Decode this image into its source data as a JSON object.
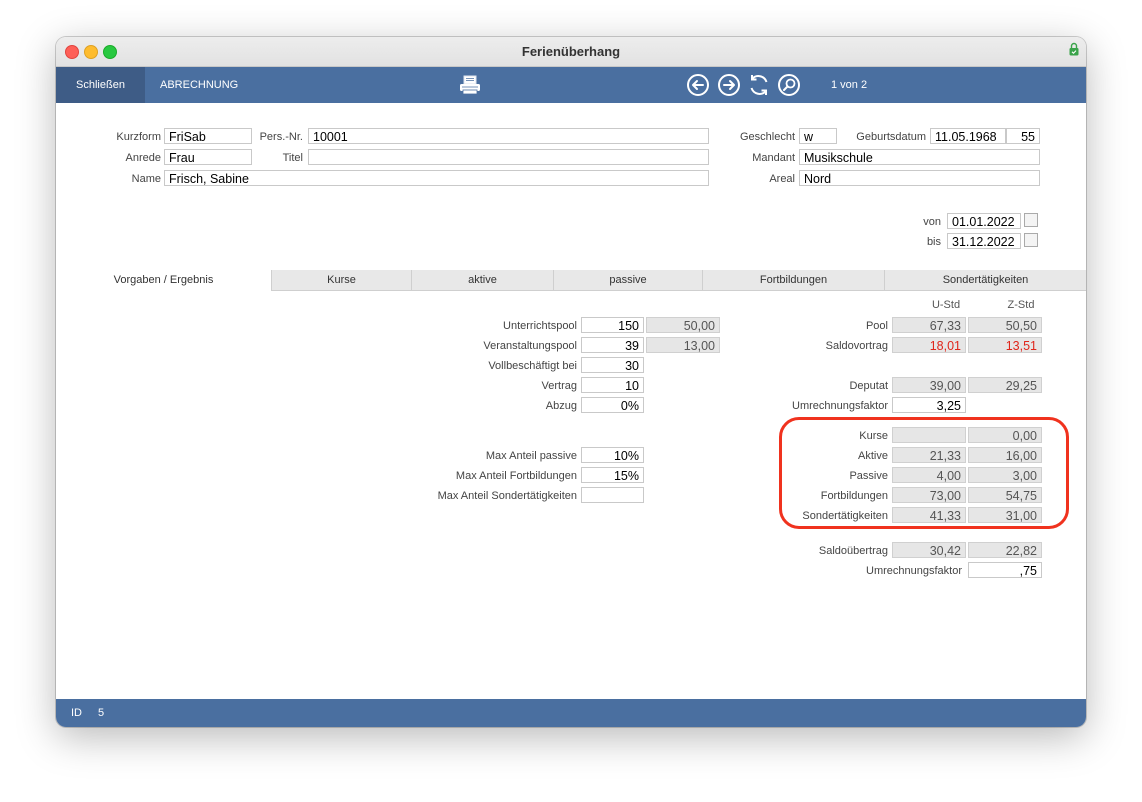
{
  "window": {
    "title": "Ferienüberhang"
  },
  "toolbar": {
    "close_label": "Schließen",
    "billing_label": "ABRECHNUNG",
    "record_info": "1 von 2"
  },
  "person": {
    "kurzform_label": "Kurzform",
    "kurzform": "FriSab",
    "persnr_label": "Pers.-Nr.",
    "persnr": "10001",
    "anrede_label": "Anrede",
    "anrede": "Frau",
    "titel_label": "Titel",
    "titel": "",
    "name_label": "Name",
    "name": "Frisch, Sabine",
    "geschlecht_label": "Geschlecht",
    "geschlecht": "w",
    "geburtsdatum_label": "Geburtsdatum",
    "geburtsdatum": "11.05.1968",
    "alter": "55",
    "mandant_label": "Mandant",
    "mandant": "Musikschule",
    "areal_label": "Areal",
    "areal": "Nord"
  },
  "period": {
    "von_label": "von",
    "von": "01.01.2022",
    "bis_label": "bis",
    "bis": "31.12.2022"
  },
  "tabs": [
    "Vorgaben / Ergebnis",
    "Kurse",
    "aktive",
    "passive",
    "Fortbildungen",
    "Sondertätigkeiten"
  ],
  "left": {
    "unterrichtspool_label": "Unterrichtspool",
    "unterrichtspool": "150",
    "unterrichtspool_z": "50,00",
    "veranstaltungspool_label": "Veranstaltungspool",
    "veranstaltungspool": "39",
    "veranstaltungspool_z": "13,00",
    "vollbeschaeftigt_label": "Vollbeschäftigt bei",
    "vollbeschaeftigt": "30",
    "vertrag_label": "Vertrag",
    "vertrag": "10",
    "abzug_label": "Abzug",
    "abzug": "0%",
    "max_passive_label": "Max Anteil passive",
    "max_passive": "10%",
    "max_fortbildungen_label": "Max Anteil Fortbildungen",
    "max_fortbildungen": "15%",
    "max_sonder_label": "Max Anteil Sondertätigkeiten",
    "max_sonder": ""
  },
  "right": {
    "col_u": "U-Std",
    "col_z": "Z-Std",
    "pool_label": "Pool",
    "pool_u": "67,33",
    "pool_z": "50,50",
    "saldovortrag_label": "Saldovortrag",
    "saldovortrag_u": "18,01",
    "saldovortrag_z": "13,51",
    "deputat_label": "Deputat",
    "deputat_u": "39,00",
    "deputat_z": "29,25",
    "umrechnung1_label": "Umrechnungsfaktor",
    "umrechnung1": "3,25",
    "kurse_label": "Kurse",
    "kurse_u": "",
    "kurse_z": "0,00",
    "aktive_label": "Aktive",
    "aktive_u": "21,33",
    "aktive_z": "16,00",
    "passive_label": "Passive",
    "passive_u": "4,00",
    "passive_z": "3,00",
    "fortbildungen_label": "Fortbildungen",
    "fortbildungen_u": "73,00",
    "fortbildungen_z": "54,75",
    "sonder_label": "Sondertätigkeiten",
    "sonder_u": "41,33",
    "sonder_z": "31,00",
    "saldouebertrag_label": "Saldoübertrag",
    "saldouebertrag_u": "30,42",
    "saldouebertrag_z": "22,82",
    "umrechnung2_label": "Umrechnungsfaktor",
    "umrechnung2": ",75"
  },
  "status": {
    "id_label": "ID",
    "id": "5"
  },
  "colors": {
    "toolbar": "#4a6fa0",
    "highlight": "#f0321e",
    "negative_text": "#e0261b"
  },
  "icons": [
    "printer-icon",
    "arrow-left-icon",
    "arrow-right-icon",
    "refresh-icon",
    "search-icon",
    "calendar-icon",
    "lock-icon"
  ]
}
